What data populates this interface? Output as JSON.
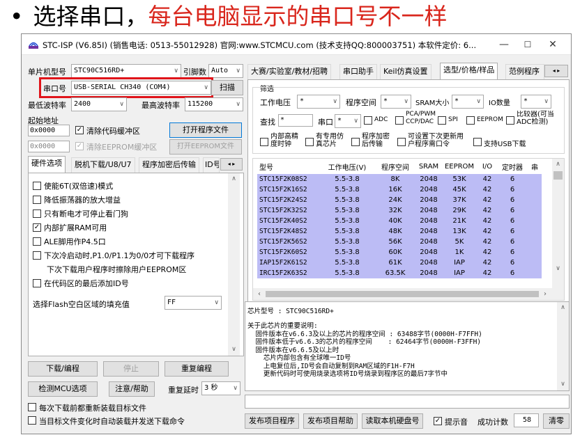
{
  "slide": {
    "bullet": "•",
    "title_black": "选择串口，",
    "title_red": "每台电脑显示的串口号不一样"
  },
  "window": {
    "title": "STC-ISP (V6.85I) (销售电话: 0513-55012928) 官网:www.STCMCU.com  (技术支持QQ:800003751) 本软件定价: 6...",
    "minimize": "—",
    "maximize": "☐",
    "close": "✕"
  },
  "left": {
    "mcu_type_label": "单片机型号",
    "mcu_type_value": "STC90C516RD+",
    "pin_label": "引脚数",
    "pin_value": "Auto",
    "port_label": "串口号",
    "port_value": "USB-SERIAL CH340 (COM4)",
    "scan_button": "扫描",
    "min_baud_label": "最低波特率",
    "min_baud_value": "2400",
    "max_baud_label": "最高波特率",
    "max_baud_value": "115200",
    "start_addr_label": "起始地址",
    "code_addr": "0x0000",
    "clear_code_label": "清除代码缓冲区",
    "open_program_button": "打开程序文件",
    "eeprom_addr": "0x0000",
    "clear_eeprom_label": "清除EEPROM缓冲区",
    "open_eeprom_button": "打开EEPROM文件",
    "tabs": [
      "硬件选项",
      "脱机下载/U8/U7",
      "程序加密后传输",
      "ID号"
    ],
    "options": [
      {
        "label": "使能6T(双倍速)模式",
        "checked": false
      },
      {
        "label": "降低振荡器的放大增益",
        "checked": false
      },
      {
        "label": "只有断电才可停止看门狗",
        "checked": false
      },
      {
        "label": "内部扩展RAM可用",
        "checked": true
      },
      {
        "label": "ALE脚用作P4.5口",
        "checked": false
      },
      {
        "label": "下次冷启动时,P1.0/P1.1为0/0才可下载程序",
        "checked": false
      },
      {
        "label": "下次下载用户程序时擦除用户EEPROM区",
        "checked": false,
        "hidden_box": true
      },
      {
        "label": "在代码区的最后添加ID号",
        "checked": false
      }
    ],
    "flash_fill_label": "选择Flash空白区域的填充值",
    "flash_fill_value": "FF",
    "download_button": "下载/编程",
    "stop_button": "停止",
    "reprogram_button": "重复编程",
    "detect_button": "检测MCU选项",
    "help_button": "注意/帮助",
    "repeat_delay_label": "重复延时",
    "repeat_delay_value": "3 秒",
    "reload_label": "每次下载前都重新装载目标文件",
    "autoload_label": "当目标文件变化时自动装载并发送下载命令"
  },
  "right": {
    "tabs": [
      "大赛/实验室/教材/招聘",
      "串口助手",
      "Keil仿真设置",
      "选型/价格/样品",
      "范例程序"
    ],
    "filter_label": "筛选",
    "voltage_label": "工作电压",
    "voltage_value": "*",
    "flash_label": "程序空间",
    "flash_value": "*",
    "sram_label": "SRAM大小",
    "sram_value": "*",
    "io_label": "IO数量",
    "io_value": "*",
    "search_label": "查找",
    "search_value": "*",
    "uart_label": "串口",
    "uart_value": "*",
    "adc_label": "ADC",
    "pca_label": "PCA/PWM CCP/DAC",
    "spi_label": "SPI",
    "eeprom_label": "EEPROM",
    "comparator_label": "比较器(可当ADC检测)",
    "rc_label": "内部高精度时钟",
    "emu_label": "有专用仿真芯片",
    "encrypt_label": "程序加密后传输",
    "custom_label": "可设置下次更新用户程序需口令",
    "usb_label": "支持USB下载",
    "columns": [
      "型号",
      "工作电压(V)",
      "程序空间",
      "SRAM",
      "EEPROM",
      "I/O",
      "定时器",
      "串"
    ],
    "rows": [
      [
        "STC15F2K08S2",
        "5.5-3.8",
        "8K",
        "2048",
        "53K",
        "42",
        "6"
      ],
      [
        "STC15F2K16S2",
        "5.5-3.8",
        "16K",
        "2048",
        "45K",
        "42",
        "6"
      ],
      [
        "STC15F2K24S2",
        "5.5-3.8",
        "24K",
        "2048",
        "37K",
        "42",
        "6"
      ],
      [
        "STC15F2K32S2",
        "5.5-3.8",
        "32K",
        "2048",
        "29K",
        "42",
        "6"
      ],
      [
        "STC15F2K40S2",
        "5.5-3.8",
        "40K",
        "2048",
        "21K",
        "42",
        "6"
      ],
      [
        "STC15F2K48S2",
        "5.5-3.8",
        "48K",
        "2048",
        "13K",
        "42",
        "6"
      ],
      [
        "STC15F2K56S2",
        "5.5-3.8",
        "56K",
        "2048",
        "5K",
        "42",
        "6"
      ],
      [
        "STC15F2K60S2",
        "5.5-3.8",
        "60K",
        "2048",
        "1K",
        "42",
        "6"
      ],
      [
        "IAP15F2K61S2",
        "5.5-3.8",
        "61K",
        "2048",
        "IAP",
        "42",
        "6"
      ],
      [
        "IRC15F2K63S2",
        "5.5-3.8",
        "63.5K",
        "2048",
        "IAP",
        "42",
        "6"
      ]
    ],
    "chip_line": "芯片型号 : STC90C516RD+",
    "info_text": "关于此芯片的重要说明:\n  固件版本在v6.6.3及以上的芯片的程序空间 : 63488字节(0000H-F7FFH)\n  固件版本低于v6.6.3的芯片的程序空间    : 62464字节(0000H-F3FFH)\n  固件版本在v6.6.5及以上时\n    芯片内部包含有全球唯一ID号\n    上电复位后,ID号会自动复制到RAM区域的F1H-F7H\n    更新代码时可使用烧录选项将ID号烧录到程序区的最后7字节中",
    "publish_button": "发布项目程序",
    "publish_help_button": "发布项目帮助",
    "read_disk_button": "读取本机硬盘号",
    "beep_label": "提示音",
    "count_label": "成功计数",
    "count_value": "58",
    "clear_button": "清零"
  },
  "colors": {
    "selected_rows": "#bcbcf5",
    "highlight_box": "#e0141a",
    "title_red": "#d9261c"
  }
}
